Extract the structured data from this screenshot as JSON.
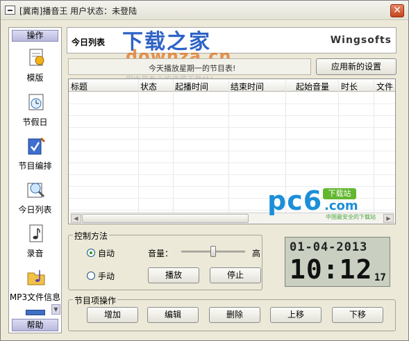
{
  "window": {
    "title": "[冀南]播音王  用户状态：未登陆"
  },
  "sidebar": {
    "header": "操作",
    "footer": "帮助",
    "items": [
      {
        "label": "模版",
        "icon": "template-icon"
      },
      {
        "label": "节假日",
        "icon": "holiday-clock-icon"
      },
      {
        "label": "节目编排",
        "icon": "program-edit-icon"
      },
      {
        "label": "今日列表",
        "icon": "today-list-icon"
      },
      {
        "label": "录音",
        "icon": "record-icon"
      },
      {
        "label": "MP3文件信息",
        "icon": "mp3-info-icon"
      }
    ]
  },
  "header": {
    "title": "今日列表",
    "brand": "Wingsofts"
  },
  "watermark": {
    "title": "下载之家",
    "domain": "downza.cn",
    "slogan": "国内最专业的资源下载站！",
    "pc6_main": "pc6",
    "pc6_badge": "下载站",
    "pc6_com": ".com",
    "pc6_sub": "中国最安全的下载站"
  },
  "notice": {
    "text": "今天播放星期一的节目表!"
  },
  "buttons": {
    "apply": "应用新的设置"
  },
  "table": {
    "columns": [
      "标题",
      "状态",
      "起播时间",
      "结束时间",
      "起始音量",
      "时长",
      "文件"
    ]
  },
  "control": {
    "legend": "控制方法",
    "auto": "自动",
    "manual": "手动",
    "auto_selected": true,
    "volume_label": "音量：",
    "volume_high": "高",
    "volume_level": 0.5,
    "play": "播放",
    "stop": "停止"
  },
  "program_ops": {
    "legend": "节目项操作",
    "add": "增加",
    "edit": "编辑",
    "delete": "删除",
    "up": "上移",
    "down": "下移"
  },
  "clock": {
    "date": "01-04-2013",
    "time": "10:12",
    "seconds": "17"
  }
}
